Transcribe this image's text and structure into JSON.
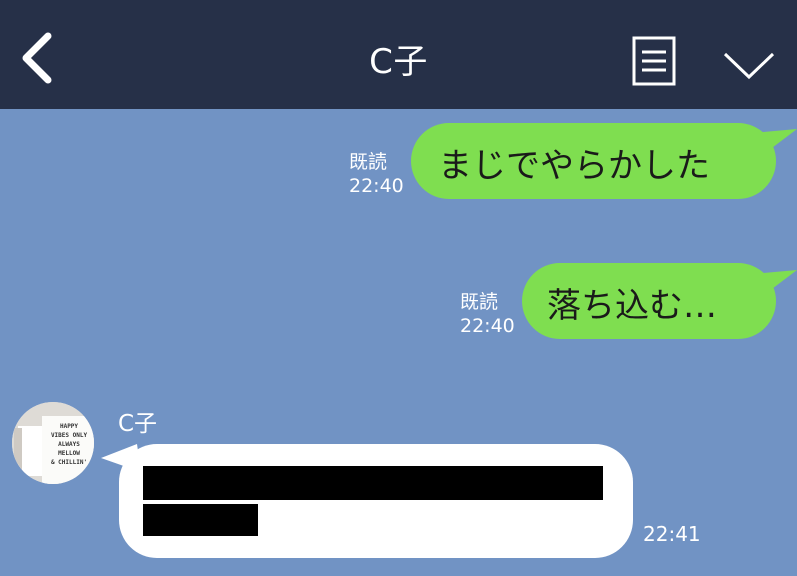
{
  "header": {
    "title": "C子",
    "back_icon": "chevron-left-icon",
    "menu_icon": "notes-icon",
    "collapse_icon": "chevron-down-icon"
  },
  "messages": [
    {
      "direction": "outgoing",
      "status": "既読",
      "time": "22:40",
      "text": "まじでやらかした"
    },
    {
      "direction": "outgoing",
      "status": "既読",
      "time": "22:40",
      "text": "落ち込む…"
    },
    {
      "direction": "incoming",
      "sender": "C子",
      "time": "22:41",
      "text": ""
    }
  ],
  "avatar": {
    "lines": [
      "HAPPY",
      "VIBES ONLY",
      "ALWAYS",
      "MELLOW",
      "& CHILLIN'"
    ]
  },
  "colors": {
    "header_bg": "#263048",
    "chat_bg": "#7193c4",
    "outgoing_bubble": "#7fde50",
    "incoming_bubble": "#ffffff"
  }
}
